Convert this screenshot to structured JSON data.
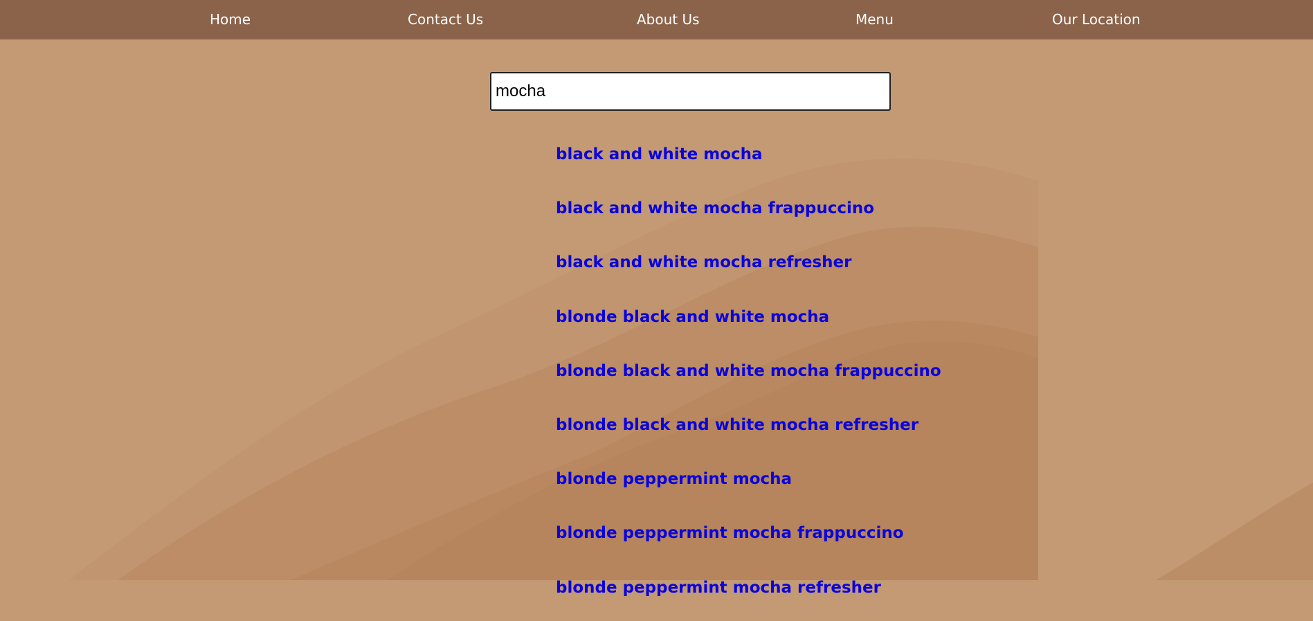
{
  "nav": {
    "items": [
      {
        "label": "Home"
      },
      {
        "label": "Contact Us"
      },
      {
        "label": "About Us"
      },
      {
        "label": "Menu"
      },
      {
        "label": "Our Location"
      }
    ]
  },
  "search": {
    "value": "mocha"
  },
  "results": [
    {
      "label": "black and white mocha"
    },
    {
      "label": "black and white mocha frappuccino"
    },
    {
      "label": "black and white mocha refresher"
    },
    {
      "label": "blonde black and white mocha"
    },
    {
      "label": "blonde black and white mocha frappuccino"
    },
    {
      "label": "blonde black and white mocha refresher"
    },
    {
      "label": "blonde peppermint mocha"
    },
    {
      "label": "blonde peppermint mocha frappuccino"
    },
    {
      "label": "blonde peppermint mocha refresher"
    }
  ],
  "colors": {
    "nav_background": "#8b634a",
    "nav_text": "#ffffff",
    "page_background": "#c49a74",
    "link": "#0b05d9",
    "search_border": "#1f1f1f"
  }
}
